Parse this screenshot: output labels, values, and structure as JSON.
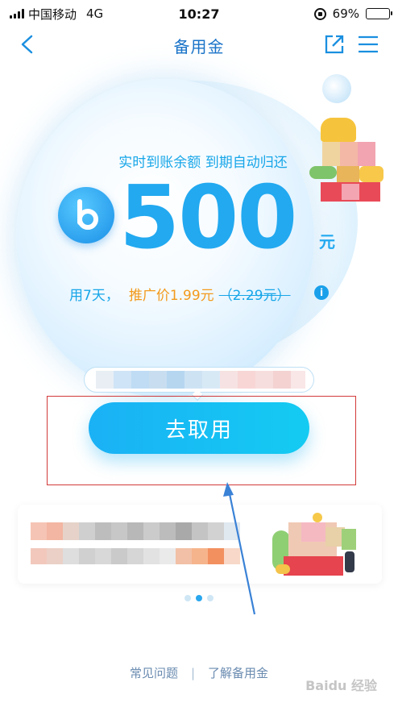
{
  "status": {
    "carrier": "中国移动",
    "network": "4G",
    "time": "10:27",
    "battery": "69%",
    "battery_level": 0.69
  },
  "nav": {
    "title": "备用金",
    "back_icon": "chevron-left-icon",
    "share_icon": "share-icon",
    "menu_icon": "menu-icon"
  },
  "offer": {
    "subtitle": "实时到账余额 到期自动归还",
    "amount": "500",
    "unit": "元",
    "term": "用7天，",
    "promo_price": "推广价1.99元",
    "original_price": "（2.29元）"
  },
  "cta": {
    "label": "去取用"
  },
  "pager": {
    "count": 3,
    "active_index": 1
  },
  "footer": {
    "faq": "常见问题",
    "about": "了解备用金",
    "separator": "|"
  },
  "watermark": "Baidu 经验",
  "colors": {
    "accent": "#22a9f0",
    "nav_blue": "#1a73c8",
    "promo_orange": "#f39a1c",
    "highlight_red": "#d23a3a"
  }
}
